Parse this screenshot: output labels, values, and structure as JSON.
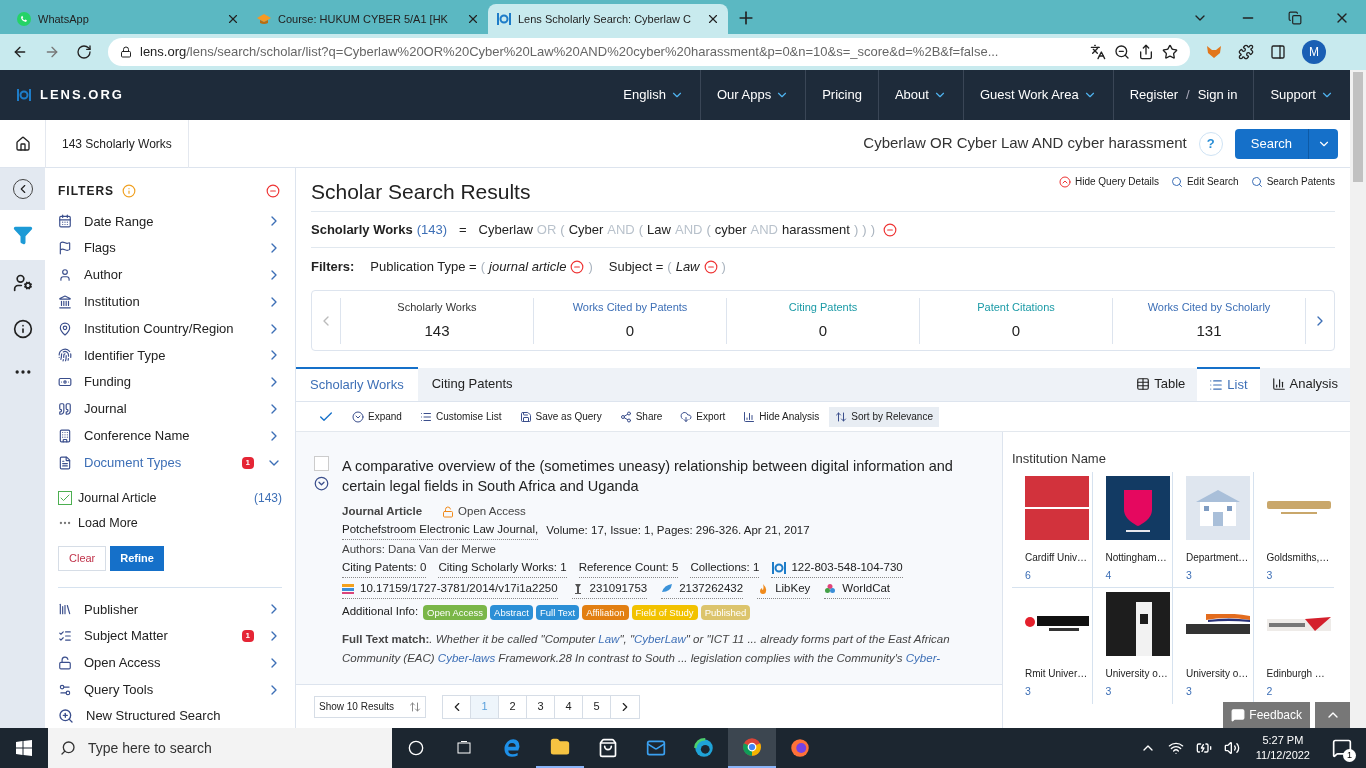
{
  "browser": {
    "tabs": [
      {
        "title": "WhatsApp",
        "selected": false
      },
      {
        "title": "Course: HUKUM CYBER 5/A1 [HK",
        "selected": false
      },
      {
        "title": "Lens Scholarly Search: Cyberlaw C",
        "selected": true
      }
    ],
    "url_host": "lens.org",
    "url_path": "/lens/search/scholar/list?q=Cyberlaw%20OR%20Cyber%20Law%20AND%20cyber%20harassment&p=0&n=10&s=_score&d=%2B&f=false...",
    "profile": "M"
  },
  "nav": {
    "logo": "LENS.ORG",
    "items": [
      {
        "label": "English",
        "kind": "menu"
      },
      {
        "label": "Our Apps",
        "kind": "menu"
      },
      {
        "label": "Pricing",
        "kind": "link"
      },
      {
        "label": "About",
        "kind": "menu"
      },
      {
        "label": "Guest Work Area",
        "kind": "menu"
      },
      {
        "label": "Register",
        "kind": "auth"
      },
      {
        "label": "/",
        "kind": "slash"
      },
      {
        "label": "Sign in",
        "kind": "auth"
      },
      {
        "label": "Support",
        "kind": "menu"
      }
    ]
  },
  "breadcrumb": "143 Scholarly Works",
  "search": {
    "query": "Cyberlaw OR Cyber Law AND cyber harassment",
    "help": "?",
    "button": "Search"
  },
  "query_links": [
    "Hide Query Details",
    "Edit Search",
    "Search Patents"
  ],
  "title": "Scholar Search Results",
  "summary": {
    "label": "Scholarly Works",
    "count": "(143)",
    "equals": "=",
    "segments": [
      {
        "text": "Cyberlaw",
        "kind": "term"
      },
      {
        "text": "OR",
        "kind": "op"
      },
      {
        "text": "(",
        "kind": "paren"
      },
      {
        "text": "Cyber",
        "kind": "term"
      },
      {
        "text": "AND",
        "kind": "op"
      },
      {
        "text": "(",
        "kind": "paren"
      },
      {
        "text": "Law",
        "kind": "term"
      },
      {
        "text": "AND",
        "kind": "op"
      },
      {
        "text": "(",
        "kind": "paren"
      },
      {
        "text": "cyber",
        "kind": "term"
      },
      {
        "text": "AND",
        "kind": "op"
      },
      {
        "text": "harassment",
        "kind": "term"
      },
      {
        "text": ")",
        "kind": "paren"
      },
      {
        "text": ")",
        "kind": "paren"
      },
      {
        "text": ")",
        "kind": "paren"
      }
    ]
  },
  "filters_line": {
    "label": "Filters:",
    "items": [
      {
        "field": "Publication Type =",
        "open": "(",
        "value": "journal article",
        "close": ")"
      },
      {
        "field": "Subject =",
        "open": "(",
        "value": "Law",
        "close": ")"
      }
    ]
  },
  "stats": [
    {
      "label": "Scholarly Works",
      "value": "143",
      "color": "#333333"
    },
    {
      "label": "Works Cited by Patents",
      "value": "0",
      "color": "#3d6fb6"
    },
    {
      "label": "Citing Patents",
      "value": "0",
      "color": "#1a9aa6"
    },
    {
      "label": "Patent Citations",
      "value": "0",
      "color": "#1a9aa6"
    },
    {
      "label": "Works Cited by Scholarly",
      "value": "131",
      "color": "#3d6fb6"
    }
  ],
  "result_tabs": [
    {
      "label": "Scholarly Works",
      "selected": true
    },
    {
      "label": "Citing Patents",
      "selected": false
    }
  ],
  "view_tabs": [
    {
      "label": "Table",
      "selected": false
    },
    {
      "label": "List",
      "selected": true
    },
    {
      "label": "Analysis",
      "selected": false
    }
  ],
  "toolbar": [
    "Expand",
    "Customise List",
    "Save as Query",
    "Share",
    "Export",
    "Hide Analysis",
    "Sort by Relevance"
  ],
  "result": {
    "checked": false,
    "title": "A comparative overview of the (sometimes uneasy) relationship between digital information and certain legal fields in South Africa and Uganda",
    "type": "Journal Article",
    "access": "Open Access",
    "journal": "Potchefstroom Electronic Law Journal,",
    "details": "Volume: 17,  Issue: 1,  Pages: 296-326.  Apr 21, 2017",
    "authors": "Authors: Dana Van der Merwe",
    "metrics": [
      "Citing Patents: 0",
      "Citing Scholarly Works: 1",
      "Reference Count: 5",
      "Collections: 1"
    ],
    "lens_id": "122-803-548-104-730",
    "ids": [
      {
        "kind": "doi",
        "text": "10.17159/1727-3781/2014/v17i1a2250"
      },
      {
        "kind": "pmid",
        "text": "231091753"
      },
      {
        "kind": "mag",
        "text": "2137262432"
      },
      {
        "kind": "libkey",
        "text": "LibKey"
      },
      {
        "kind": "worldcat",
        "text": "WorldCat"
      }
    ],
    "info_label": "Additional Info:",
    "tags": [
      {
        "label": "Open Access",
        "color": "#7ab648"
      },
      {
        "label": "Abstract",
        "color": "#2b8fd6"
      },
      {
        "label": "Full Text",
        "color": "#2b8fd6"
      },
      {
        "label": "Affiliation",
        "color": "#e27f12"
      },
      {
        "label": "Field of Study",
        "color": "#f2c200"
      },
      {
        "label": "Published",
        "color": "#dcc46c"
      }
    ],
    "match_label": "Full Text match:",
    "match": [
      {
        "text": ". Whether it be called \"Computer ",
        "hit": false
      },
      {
        "text": "Law",
        "hit": true
      },
      {
        "text": "\", \"",
        "hit": false
      },
      {
        "text": "CyberLaw",
        "hit": true
      },
      {
        "text": "\" or \"ICT 11 ... already forms part of the East African Community (EAC) ",
        "hit": false
      },
      {
        "text": "Cyber-laws",
        "hit": true
      },
      {
        "text": " Framework.28 In contrast to South ... legislation complies with the Community's ",
        "hit": false
      },
      {
        "text": "Cyber-",
        "hit": true
      }
    ]
  },
  "pagination": {
    "show": "Show 10 Results",
    "pages": [
      {
        "label": "1",
        "selected": true
      },
      {
        "label": "2",
        "selected": false
      },
      {
        "label": "3",
        "selected": false
      },
      {
        "label": "4",
        "selected": false
      },
      {
        "label": "5",
        "selected": false
      }
    ]
  },
  "institutions": {
    "title": "Institution Name",
    "items": [
      {
        "name": "Cardiff Univ…",
        "count": "6"
      },
      {
        "name": "Nottingham…",
        "count": "4"
      },
      {
        "name": "Department…",
        "count": "3"
      },
      {
        "name": "Goldsmiths,…",
        "count": "3"
      },
      {
        "name": "Rmit Univer…",
        "count": "3"
      },
      {
        "name": "University o…",
        "count": "3"
      },
      {
        "name": "University o…",
        "count": "3"
      },
      {
        "name": "Edinburgh …",
        "count": "2"
      }
    ]
  },
  "filters": {
    "title": "FILTERS",
    "before": [
      {
        "label": "Date Range"
      },
      {
        "label": "Flags"
      },
      {
        "label": "Author"
      },
      {
        "label": "Institution"
      },
      {
        "label": "Institution Country/Region"
      },
      {
        "label": "Identifier Type"
      },
      {
        "label": "Funding"
      },
      {
        "label": "Journal"
      },
      {
        "label": "Conference Name"
      }
    ],
    "expanded": {
      "label": "Document Types",
      "badge": "1",
      "expanded": true,
      "options": [
        {
          "label": "Journal Article",
          "count": "(143)",
          "checked": true
        }
      ],
      "more": "Load More",
      "clear": "Clear",
      "refine": "Refine"
    },
    "after": [
      {
        "label": "Publisher"
      },
      {
        "label": "Subject Matter",
        "badge": "1"
      },
      {
        "label": "Open Access"
      },
      {
        "label": "Query Tools"
      }
    ],
    "structured": "New Structured Search"
  },
  "feedback": "Feedback",
  "taskbar": {
    "search": "Type here to search",
    "time": "5:27 PM",
    "date": "11/12/2022",
    "notifications": "1"
  }
}
